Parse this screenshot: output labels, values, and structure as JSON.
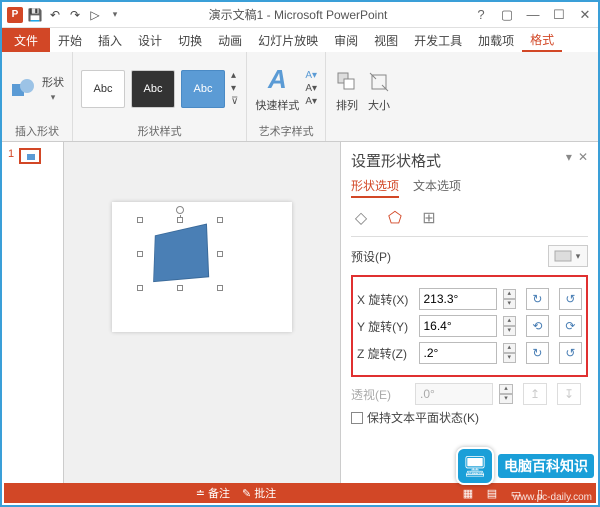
{
  "title": "演示文稿1 - Microsoft PowerPoint",
  "tabs": {
    "file": "文件",
    "home": "开始",
    "insert": "插入",
    "design": "设计",
    "transitions": "切换",
    "animations": "动画",
    "slideshow": "幻灯片放映",
    "review": "审阅",
    "view": "视图",
    "developer": "开发工具",
    "addins": "加载项",
    "format": "格式"
  },
  "ribbon": {
    "insert_shape": {
      "btn": "形状",
      "group": "插入形状"
    },
    "shape_styles": {
      "abc": "Abc",
      "group": "形状样式"
    },
    "wordart": {
      "btn": "快速样式",
      "group": "艺术字样式"
    },
    "arrange": {
      "btn": "排列"
    },
    "size": {
      "btn": "大小"
    }
  },
  "thumb": {
    "num": "1"
  },
  "pane": {
    "title": "设置形状格式",
    "tab_shape": "形状选项",
    "tab_text": "文本选项",
    "preset_label": "预设(P)",
    "x_label": "X 旋转(X)",
    "y_label": "Y 旋转(Y)",
    "z_label": "Z 旋转(Z)",
    "x_val": "213.3°",
    "y_val": "16.4°",
    "z_val": ".2°",
    "persp_label": "透视(E)",
    "persp_val": ".0°",
    "keep_flat": "保持文本平面状态(K)"
  },
  "status": {
    "notes": "备注",
    "comments": "批注"
  },
  "watermark": {
    "text": "电脑百科知识",
    "url": "www.pc-daily.com"
  }
}
